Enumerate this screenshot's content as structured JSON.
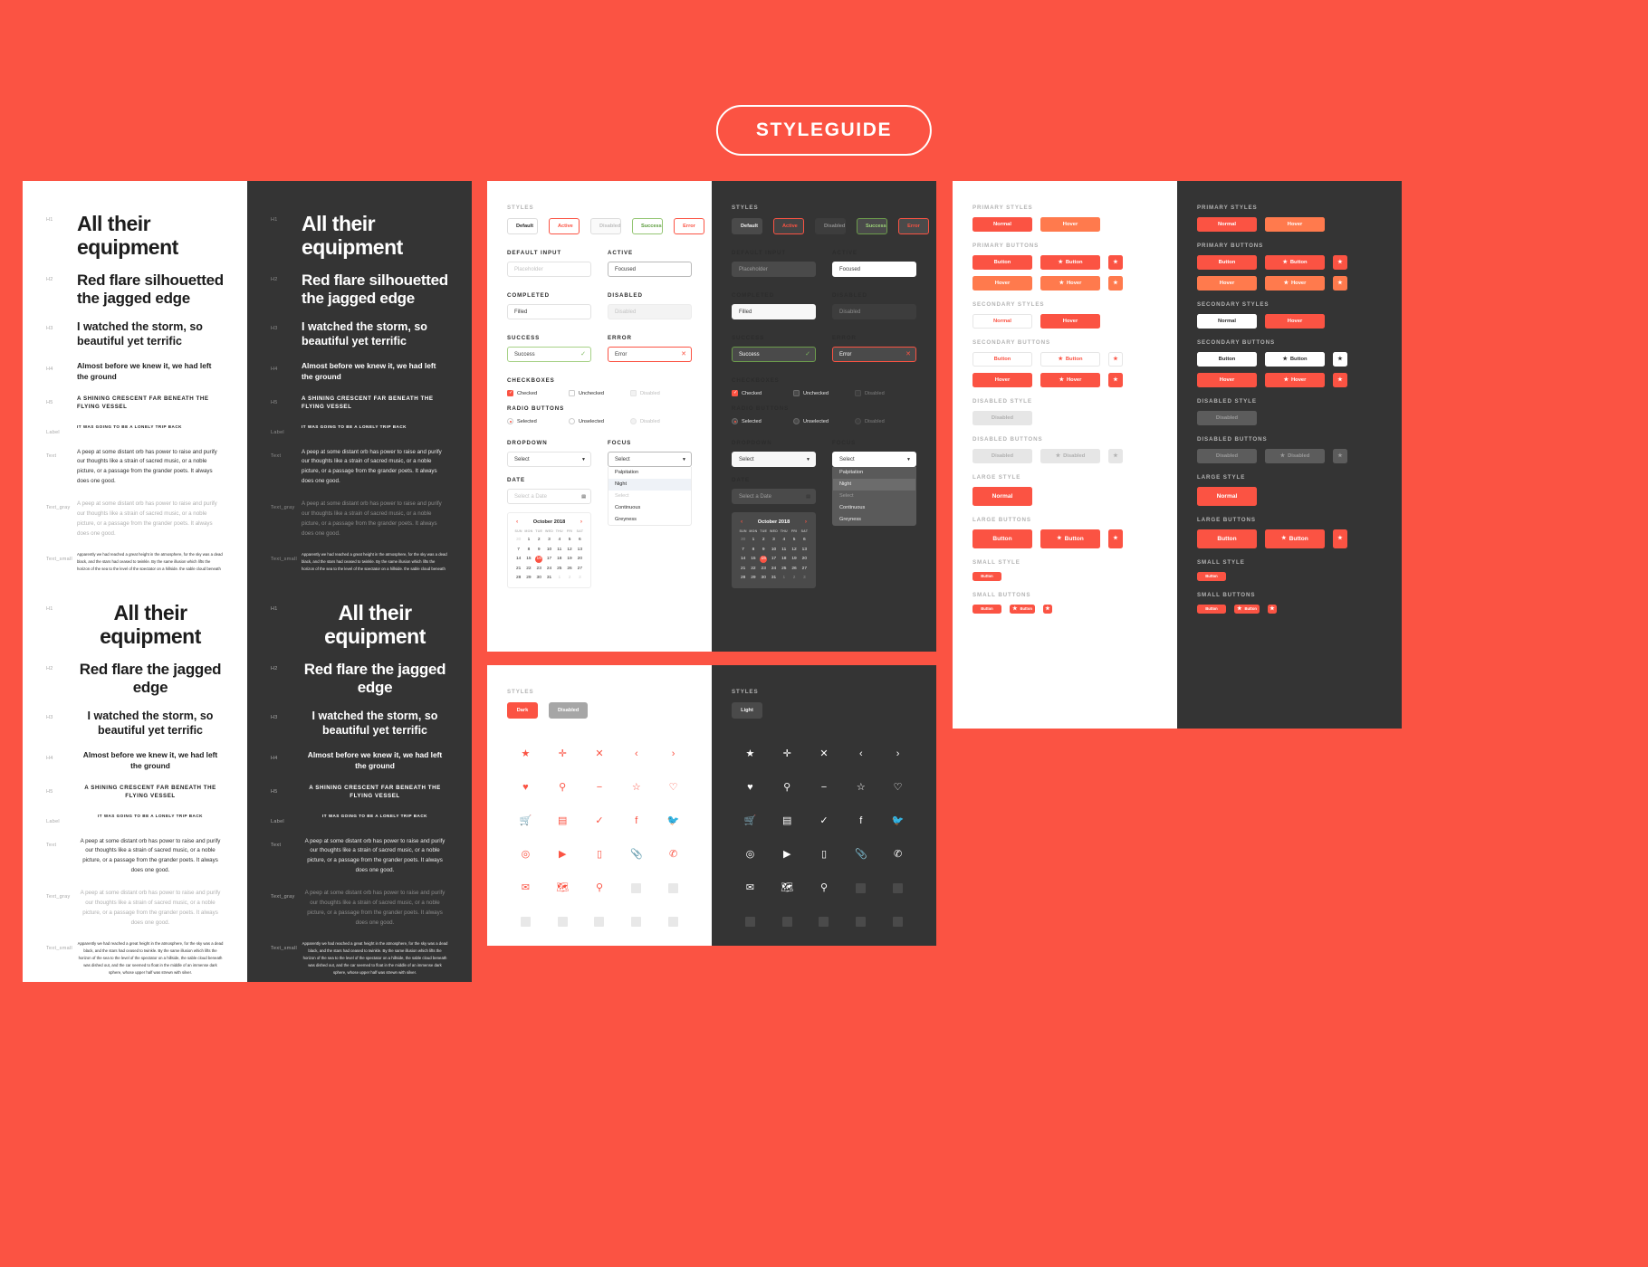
{
  "badge": {
    "title": "STYLEGUIDE"
  },
  "colors": {
    "brand": "#fb5343",
    "hover": "#ff7a4d",
    "dark": "#343434",
    "light": "#ffffff",
    "success": "#7cb85c",
    "disabled": "#e6e6e6"
  },
  "typography": {
    "tags": {
      "h1": "H1",
      "h2": "H2",
      "h3": "H3",
      "h4": "H4",
      "h5": "H5",
      "label": "Label",
      "text": "Text",
      "text_gray": "Text_gray",
      "text_small": "Text_small"
    },
    "h1": "All their equipment",
    "h2": "Red flare silhouetted the jagged edge",
    "h2_center": "Red flare the jagged edge",
    "h3": "I watched the storm, so beautiful yet terrific",
    "h4": "Almost before we knew it, we had left the ground",
    "h5": "A SHINING CRESCENT FAR BENEATH THE FLYING VESSEL",
    "label": "IT WAS GOING TO BE A LONELY TRIP BACK",
    "text": "A peep at some distant orb has power to raise and purify our thoughts like a strain of sacred music, or a noble picture, or a passage from the grander poets. It always does one good.",
    "text_gray": "A peep at some distant orb has power to raise and purify our thoughts like a strain of sacred music, or a noble picture, or a passage from the grander poets. It always does one good.",
    "text_small": "Apparently we had reached a great height in the atmosphere, for the sky was a dead black, and the stars had ceased to twinkle. By the same illusion which lifts the horizon of the sea to the level of the spectator on a hillside, the sable cloud beneath was dished out, and the car seemed to float in the middle of an immense dark sphere, whose upper half was strewn with silver."
  },
  "forms": {
    "section_styles": "STYLES",
    "chips": [
      "Default",
      "Active",
      "Disabled",
      "Success",
      "Error"
    ],
    "labels": {
      "default_input": "DEFAULT INPUT",
      "active": "ACTIVE",
      "completed": "COMPLETED",
      "disabled": "DISABLED",
      "success": "SUCCESS",
      "error": "ERROR",
      "checkboxes": "CHECKBOXES",
      "radio_buttons": "RADIO BUTTONS",
      "dropdown": "DROPDOWN",
      "focus": "FOCUS",
      "date": "DATE"
    },
    "values": {
      "placeholder": "Placeholder",
      "focused": "Focused",
      "filled": "Filled",
      "disabled": "Disabled",
      "success": "Success",
      "error": "Error",
      "select": "Select",
      "select_date": "Select a Date"
    },
    "checkboxes": [
      "Checked",
      "Unchecked",
      "Disabled"
    ],
    "radios": [
      "Selected",
      "Unselected",
      "Disabled"
    ],
    "dropdown_options": [
      "Palpitation",
      "Night",
      "Select",
      "Continuous",
      "Greyness"
    ],
    "calendar": {
      "title": "October 2018",
      "prev": "‹",
      "next": "›",
      "dow": [
        "SUN",
        "MON",
        "TUE",
        "WED",
        "THU",
        "FRI",
        "SAT"
      ],
      "selected": 16,
      "weeks": [
        [
          {
            "d": "30",
            "out": true
          },
          {
            "d": "1"
          },
          {
            "d": "2"
          },
          {
            "d": "3"
          },
          {
            "d": "4"
          },
          {
            "d": "5"
          },
          {
            "d": "6"
          }
        ],
        [
          {
            "d": "7"
          },
          {
            "d": "8"
          },
          {
            "d": "9"
          },
          {
            "d": "10"
          },
          {
            "d": "11"
          },
          {
            "d": "12"
          },
          {
            "d": "13"
          }
        ],
        [
          {
            "d": "14"
          },
          {
            "d": "15"
          },
          {
            "d": "16",
            "sel": true
          },
          {
            "d": "17"
          },
          {
            "d": "18"
          },
          {
            "d": "19"
          },
          {
            "d": "20"
          }
        ],
        [
          {
            "d": "21"
          },
          {
            "d": "22"
          },
          {
            "d": "23"
          },
          {
            "d": "24"
          },
          {
            "d": "25"
          },
          {
            "d": "26"
          },
          {
            "d": "27"
          }
        ],
        [
          {
            "d": "28"
          },
          {
            "d": "29"
          },
          {
            "d": "30"
          },
          {
            "d": "31"
          },
          {
            "d": "1",
            "out": true
          },
          {
            "d": "2",
            "out": true
          },
          {
            "d": "3",
            "out": true
          }
        ]
      ]
    }
  },
  "buttons": {
    "groups": {
      "primary_styles": "PRIMARY STYLES",
      "primary_buttons": "PRIMARY BUTTONS",
      "secondary_styles": "SECONDARY STYLES",
      "secondary_buttons": "SECONDARY BUTTONS",
      "disabled_style": "DISABLED STYLE",
      "disabled_buttons": "DISABLED BUTTONS",
      "large_style": "LARGE STYLE",
      "large_buttons": "LARGE BUTTONS",
      "small_style": "SMALL STYLE",
      "small_buttons": "SMALL BUTTONS"
    },
    "labels": {
      "normal": "Normal",
      "hover": "Hover",
      "button": "Button",
      "disabled": "Disabled",
      "star": "★"
    }
  },
  "icons": {
    "section_styles": "STYLES",
    "chip_dark": "Dark",
    "chip_disabled": "Disabled",
    "chip_light": "Light",
    "glyphs": [
      {
        "name": "star-filled-icon",
        "g": "★"
      },
      {
        "name": "plus-icon",
        "g": "✛"
      },
      {
        "name": "close-icon",
        "g": "✕"
      },
      {
        "name": "chevron-left-icon",
        "g": "‹"
      },
      {
        "name": "chevron-right-icon",
        "g": "›"
      },
      {
        "name": "heart-filled-icon",
        "g": "♥"
      },
      {
        "name": "search-icon",
        "g": "⚲"
      },
      {
        "name": "minus-icon",
        "g": "−"
      },
      {
        "name": "star-outline-icon",
        "g": "☆"
      },
      {
        "name": "heart-outline-icon",
        "g": "♡"
      },
      {
        "name": "cart-icon",
        "g": "🛒"
      },
      {
        "name": "menu-icon",
        "g": "▤"
      },
      {
        "name": "check-icon",
        "g": "✓"
      },
      {
        "name": "facebook-icon",
        "g": "f"
      },
      {
        "name": "twitter-icon",
        "g": "🐦"
      },
      {
        "name": "instagram-icon",
        "g": "◎"
      },
      {
        "name": "youtube-icon",
        "g": "▶"
      },
      {
        "name": "mobile-icon",
        "g": "▯"
      },
      {
        "name": "attachment-icon",
        "g": "📎"
      },
      {
        "name": "phone-icon",
        "g": "✆"
      },
      {
        "name": "mail-icon",
        "g": "✉"
      },
      {
        "name": "map-icon",
        "g": "🗺"
      },
      {
        "name": "location-pin-icon",
        "g": "⚲"
      },
      {
        "name": "placeholder-icon",
        "g": ""
      },
      {
        "name": "placeholder-icon",
        "g": ""
      },
      {
        "name": "placeholder-icon",
        "g": ""
      },
      {
        "name": "placeholder-icon",
        "g": ""
      },
      {
        "name": "placeholder-icon",
        "g": ""
      },
      {
        "name": "placeholder-icon",
        "g": ""
      },
      {
        "name": "placeholder-icon",
        "g": ""
      }
    ]
  }
}
